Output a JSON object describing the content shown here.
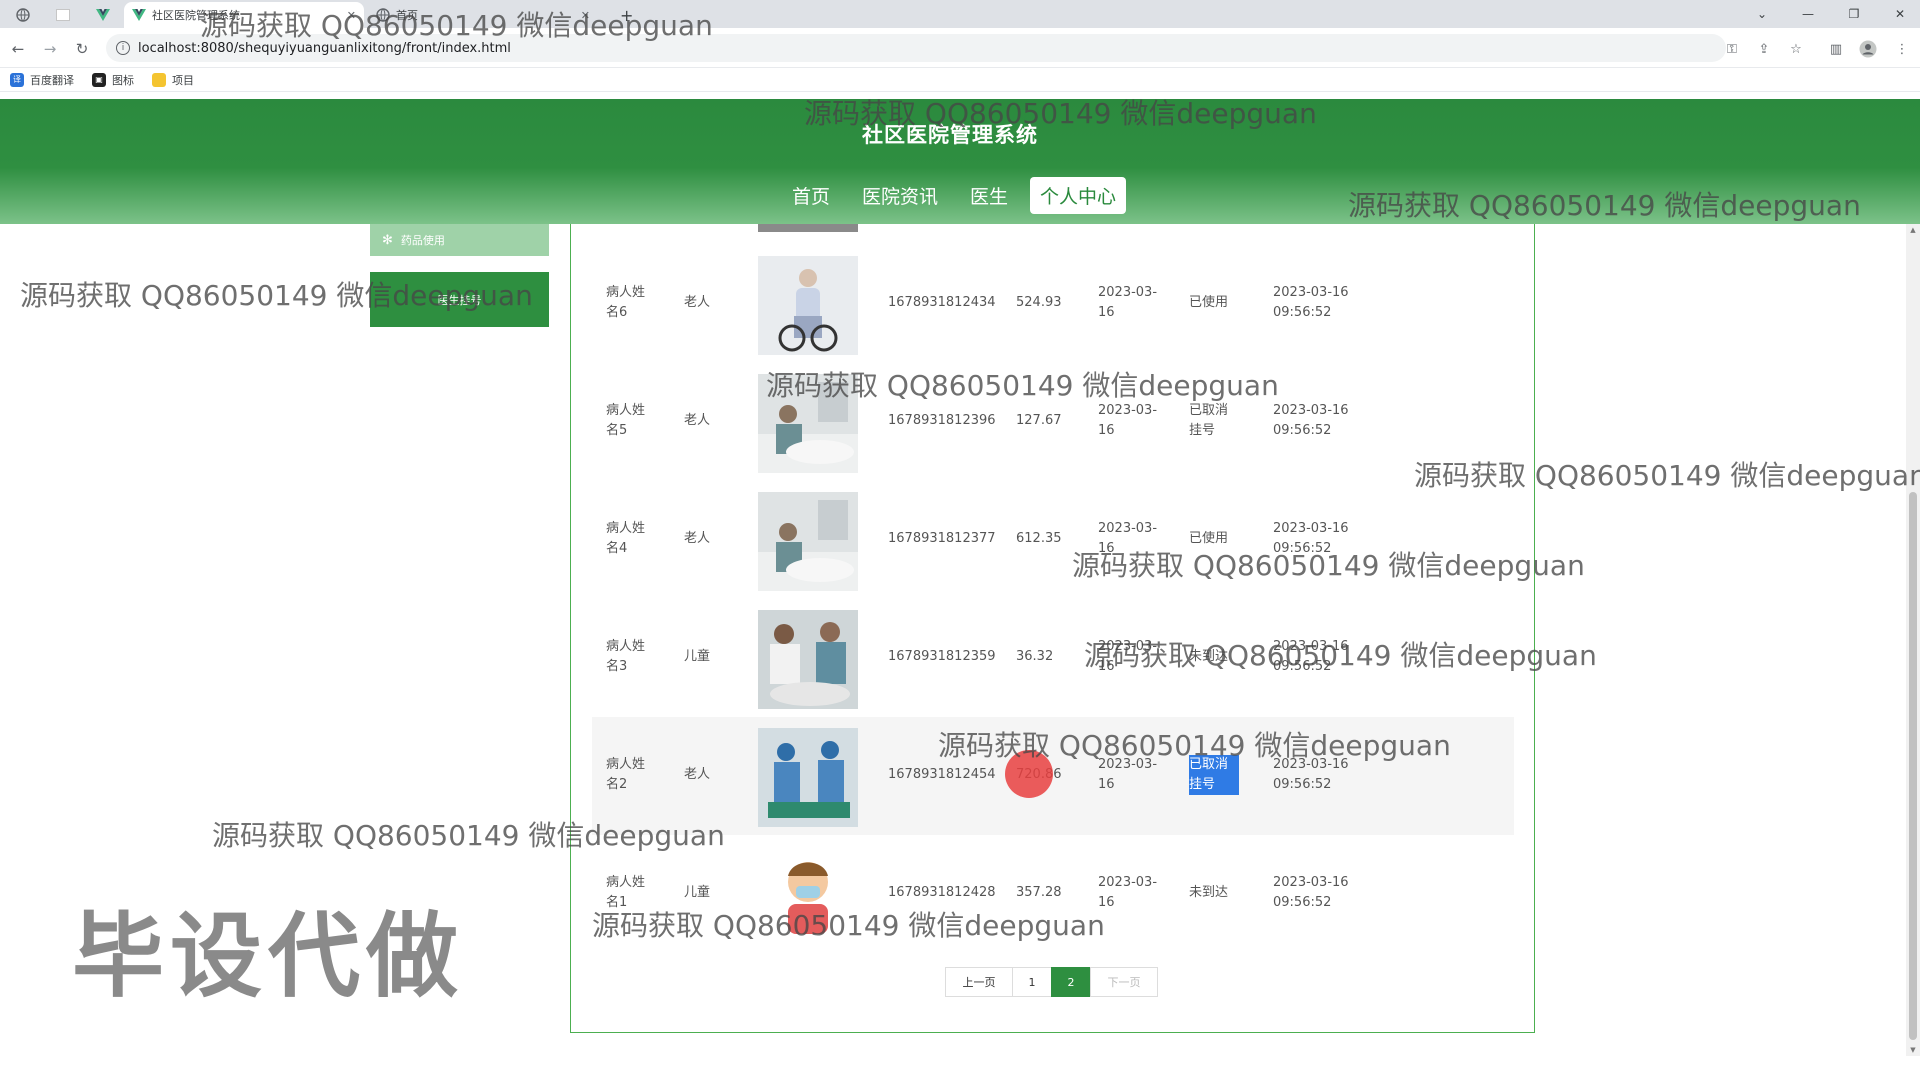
{
  "browser": {
    "tabs": [
      {
        "icon": "globe-icon",
        "label": ""
      },
      {
        "icon": "blank-tab-icon",
        "label": ""
      },
      {
        "icon": "vue-logo-icon",
        "label": ""
      },
      {
        "icon": "vue-logo-icon",
        "label": "社区医院管理系统"
      },
      {
        "icon": "globe-icon",
        "label": "首页"
      }
    ],
    "new_tab": "+",
    "url": "localhost:8080/shequyiyuanguanlixitong/front/index.html",
    "bookmarks": [
      {
        "label": "百度翻译",
        "color": "#2b72d8"
      },
      {
        "label": "图标",
        "color": "#222222"
      },
      {
        "label": "项目",
        "color": "#f4c430"
      }
    ]
  },
  "site": {
    "title": "社区医院管理系统",
    "nav": [
      {
        "label": "首页",
        "active": false
      },
      {
        "label": "医院资讯",
        "active": false
      },
      {
        "label": "医生",
        "active": false
      },
      {
        "label": "个人中心",
        "active": true
      }
    ],
    "theme_color": "#2e8f40"
  },
  "sidebar": {
    "items": [
      {
        "label": "药品使用"
      },
      {
        "label": "医生挂号"
      }
    ]
  },
  "records": [
    {
      "name": "病人姓名6",
      "type": "老人",
      "image": "elderly-patient-wheelchair-photo",
      "number": "1678931812434",
      "fee": "524.93",
      "date": "2023-03-16",
      "status": "已使用",
      "time": "2023-03-16 09:56:52"
    },
    {
      "name": "病人姓名5",
      "type": "老人",
      "image": "hospital-ward-photo",
      "number": "1678931812396",
      "fee": "127.67",
      "date": "2023-03-16",
      "status": "已取消挂号",
      "time": "2023-03-16 09:56:52"
    },
    {
      "name": "病人姓名4",
      "type": "老人",
      "image": "hospital-ward-photo",
      "number": "1678931812377",
      "fee": "612.35",
      "date": "2023-03-16",
      "status": "已使用",
      "time": "2023-03-16 09:56:52"
    },
    {
      "name": "病人姓名3",
      "type": "儿童",
      "image": "doctors-treating-patient-photo",
      "number": "1678931812359",
      "fee": "36.32",
      "date": "2023-03-16",
      "status": "未到达",
      "time": "2023-03-16 09:56:52"
    },
    {
      "name": "病人姓名2",
      "type": "老人",
      "image": "surgery-room-photo",
      "number": "1678931812454",
      "fee": "720.86",
      "date": "2023-03-16",
      "status": "已取消挂号",
      "time": "2023-03-16 09:56:52"
    },
    {
      "name": "病人姓名1",
      "type": "儿童",
      "image": "child-with-mask-illustration",
      "number": "1678931812428",
      "fee": "357.28",
      "date": "2023-03-16",
      "status": "未到达",
      "time": "2023-03-16 09:56:52"
    }
  ],
  "pagination": {
    "prev": "上一页",
    "pages": [
      "1",
      "2"
    ],
    "current": "2",
    "next": "下一页"
  },
  "watermark": {
    "text": "源码获取 QQ86050149 微信deepguan",
    "big_text": "毕设代做"
  }
}
